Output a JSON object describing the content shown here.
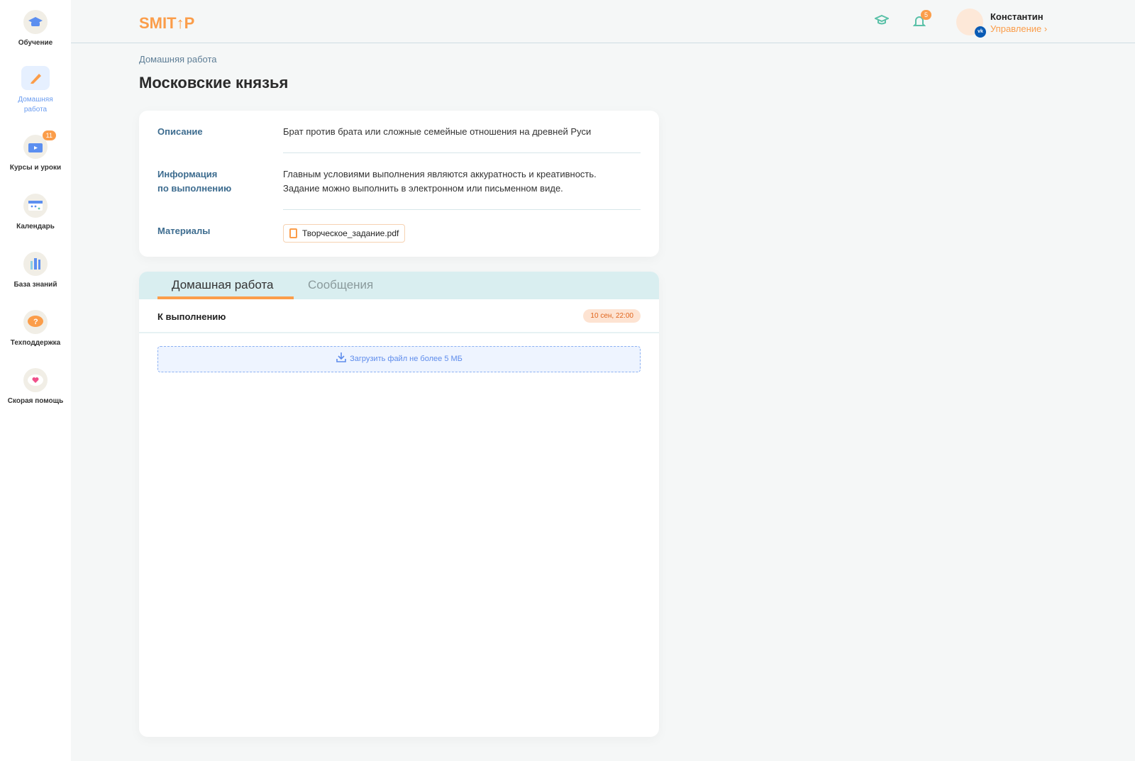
{
  "sidebar": {
    "items": [
      {
        "label": "Обучение",
        "icon": "graduation-cap-icon"
      },
      {
        "label": "Домашняя работа",
        "icon": "pencil-icon",
        "active": true
      },
      {
        "label": "Курсы и уроки",
        "icon": "video-case-icon",
        "badge": "11"
      },
      {
        "label": "Календарь",
        "icon": "calendar-icon"
      },
      {
        "label": "База знаний",
        "icon": "books-icon"
      },
      {
        "label": "Техподдержка",
        "icon": "question-bubble-icon"
      },
      {
        "label": "Скорая помощь",
        "icon": "heart-bubble-icon"
      }
    ]
  },
  "header": {
    "logo": "SMITUP",
    "notifications": "5",
    "user_name": "Константин",
    "manage": "Управление ›",
    "vk": "vk"
  },
  "page": {
    "breadcrumb": "Домашняя работа",
    "title": "Московские князья"
  },
  "info": {
    "description_label": "Описание",
    "description": "Брат против брата или сложные семейные отношения на древней Руси",
    "execution_label_1": "Информация",
    "execution_label_2": "по выполнению",
    "execution_1": "Главным условиями выполнения являются аккуратность и креативность.",
    "execution_2": "Задание можно выполнить в электронном или письменном виде.",
    "materials_label": "Материалы",
    "file": "Творческое_задание.pdf"
  },
  "work": {
    "tabs": [
      "Домашная работа",
      "Сообщения"
    ],
    "status": "К выполнению",
    "deadline": "10 сен, 22:00",
    "upload": "Загрузить файл не более 5 МБ"
  }
}
